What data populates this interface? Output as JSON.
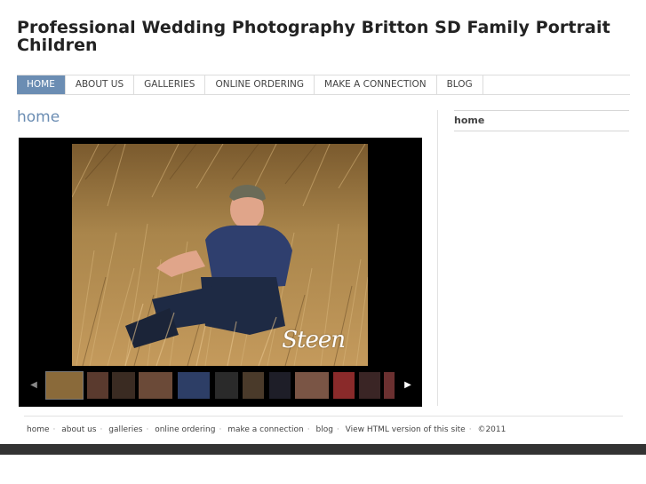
{
  "site": {
    "title": "Professional Wedding Photography Britton SD Family Portrait Children"
  },
  "nav": {
    "items": [
      {
        "label": "HOME",
        "active": true
      },
      {
        "label": "ABOUT US"
      },
      {
        "label": "GALLERIES"
      },
      {
        "label": "ONLINE ORDERING"
      },
      {
        "label": "MAKE A CONNECTION"
      },
      {
        "label": "BLOG"
      }
    ]
  },
  "page": {
    "heading": "home"
  },
  "sidebar": {
    "title": "home"
  },
  "slideshow": {
    "watermark": "Steen",
    "prev_icon": "triangle-left-icon",
    "next_icon": "triangle-right-icon",
    "thumbnail_count": 13
  },
  "footer": {
    "links": [
      "home",
      "about us",
      "galleries",
      "online ordering",
      "make a connection",
      "blog",
      "View HTML version of this site"
    ],
    "copyright": "©2011"
  },
  "colors": {
    "accent": "#6b8db3",
    "slideshow_bg": "#000000",
    "bottom_bar": "#333333"
  }
}
